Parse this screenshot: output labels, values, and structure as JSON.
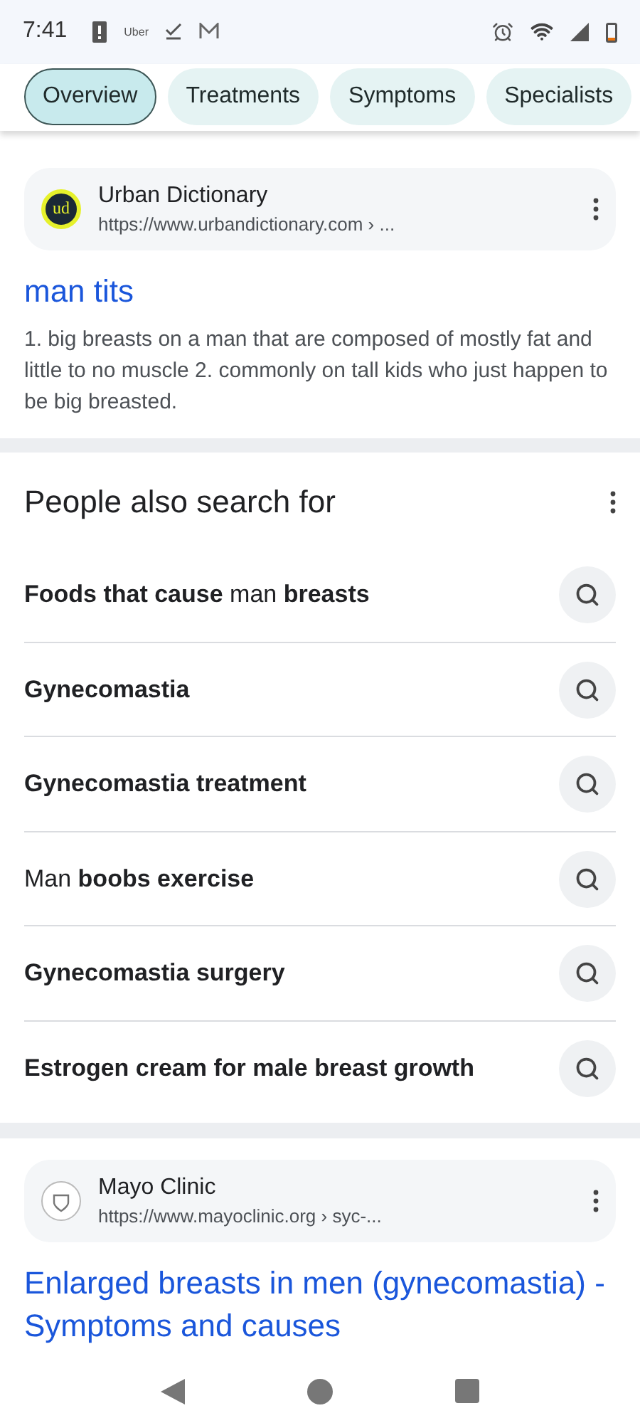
{
  "status_bar": {
    "time": "7:41",
    "uber_label": "Uber"
  },
  "tabs": [
    {
      "label": "Overview",
      "selected": true
    },
    {
      "label": "Treatments",
      "selected": false
    },
    {
      "label": "Symptoms",
      "selected": false
    },
    {
      "label": "Specialists",
      "selected": false
    }
  ],
  "result_1": {
    "logo_text": "ud",
    "site": "Urban Dictionary",
    "url": "https://www.urbandictionary.com › ...",
    "title": "man tits",
    "snippet": "1. big breasts on a man that are composed of mostly fat and little to no muscle 2. commonly on tall kids who just happen to be big breasted."
  },
  "people_also_search": {
    "heading": "People also search for",
    "items": [
      {
        "text": "**Foods that cause** man **breasts**"
      },
      {
        "text": "**Gynecomastia**"
      },
      {
        "text": "**Gynecomastia treatment**"
      },
      {
        "text": "Man **boobs exercise**"
      },
      {
        "text": "**Gynecomastia surgery**"
      },
      {
        "text": "**Estrogen cream for male breast growth**"
      }
    ]
  },
  "result_2": {
    "site": "Mayo Clinic",
    "url": "https://www.mayoclinic.org › syc-...",
    "title": "Enlarged breasts in men (gynecomastia) - Symptoms and causes"
  }
}
